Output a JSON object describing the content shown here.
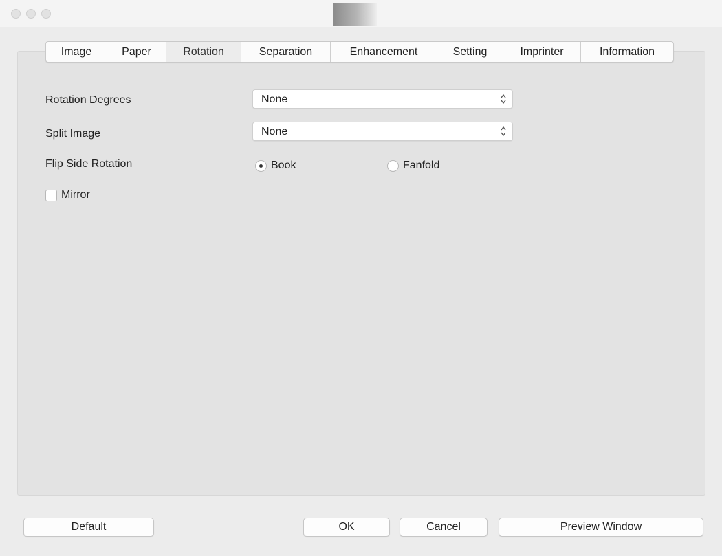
{
  "tabs": [
    {
      "label": "Image"
    },
    {
      "label": "Paper"
    },
    {
      "label": "Rotation",
      "active": true
    },
    {
      "label": "Separation"
    },
    {
      "label": "Enhancement"
    },
    {
      "label": "Setting"
    },
    {
      "label": "Imprinter"
    },
    {
      "label": "Information"
    }
  ],
  "rotation_degrees": {
    "label": "Rotation Degrees",
    "value": "None"
  },
  "split_image": {
    "label": "Split Image",
    "value": "None"
  },
  "flip_side_rotation": {
    "label": "Flip Side Rotation",
    "options": [
      {
        "label": "Book",
        "checked": true
      },
      {
        "label": "Fanfold",
        "checked": false
      }
    ]
  },
  "mirror": {
    "label": "Mirror",
    "checked": false
  },
  "buttons": {
    "default": "Default",
    "ok": "OK",
    "cancel": "Cancel",
    "preview": "Preview Window"
  }
}
